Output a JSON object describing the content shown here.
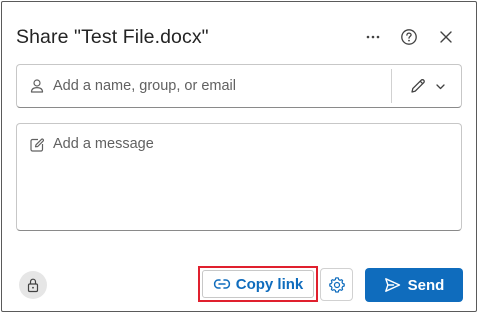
{
  "dialog": {
    "title": "Share \"Test File.docx\"",
    "header_icons": [
      "more-options-icon",
      "help-icon",
      "close-icon"
    ]
  },
  "recipients": {
    "placeholder": "Add a name, group, or email",
    "value": "",
    "icon": "person-icon",
    "permission_icons": [
      "pencil-icon",
      "chevron-down-icon"
    ]
  },
  "message": {
    "placeholder": "Add a message",
    "value": "",
    "icon": "compose-icon"
  },
  "footer": {
    "lock_icon": "lock-icon",
    "copy_link_label": "Copy link",
    "copy_link_icon": "link-icon",
    "settings_icon": "gear-icon",
    "send_label": "Send",
    "send_icon": "send-icon"
  },
  "colors": {
    "accent": "#0f6cbd",
    "highlight": "#e0202e"
  }
}
